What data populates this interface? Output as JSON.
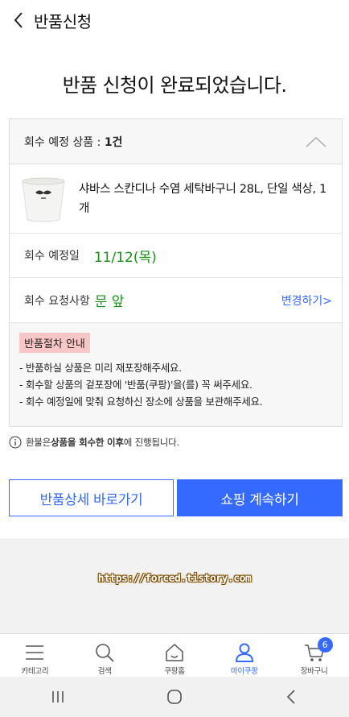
{
  "header": {
    "title": "반품신청",
    "back_icon": "chevron-left-icon"
  },
  "main": {
    "done_title": "반품 신청이 완료되었습니다."
  },
  "card": {
    "head_label": "회수 예정 상품 : ",
    "head_count": "1건",
    "product": {
      "name": "샤바스 스칸디나 수염 세탁바구니 28L, 단일 색상, 1개",
      "thumb_icon": "laundry-basket-image"
    },
    "date": {
      "label": "회수 예정일",
      "value": "11/12(목)"
    },
    "request": {
      "label": "회수 요청사항",
      "value": "문 앞",
      "change_link": "변경하기>"
    },
    "guide": {
      "title": "반품절차 안내",
      "lines": [
        "- 반품하실 상품은 미리 재포장해주세요.",
        "- 회수할 상품의 겉포장에 '반품(쿠팡)'을(를) 꼭 써주세요.",
        "- 회수 예정일에 맞춰 요청하신 장소에 상품을 보관해주세요."
      ]
    }
  },
  "refund_note": {
    "prefix": "환불은 ",
    "bold": "상품을 회수한 이후",
    "suffix": "에 진행됩니다."
  },
  "buttons": {
    "detail": "반품상세 바로가기",
    "shop": "쇼핑 계속하기"
  },
  "watermark": "https://forced.tistory.com",
  "tabbar": {
    "items": [
      {
        "label": "카테고리",
        "icon": "menu-icon"
      },
      {
        "label": "검색",
        "icon": "search-icon"
      },
      {
        "label": "쿠팡홈",
        "icon": "home-icon"
      },
      {
        "label": "마이쿠팡",
        "icon": "user-icon"
      },
      {
        "label": "장바구니",
        "icon": "cart-icon"
      }
    ],
    "cart_count": "6"
  },
  "colors": {
    "accent": "#346aff",
    "green": "#1a8f1a",
    "guide_title_bg": "#f7c6c6"
  }
}
